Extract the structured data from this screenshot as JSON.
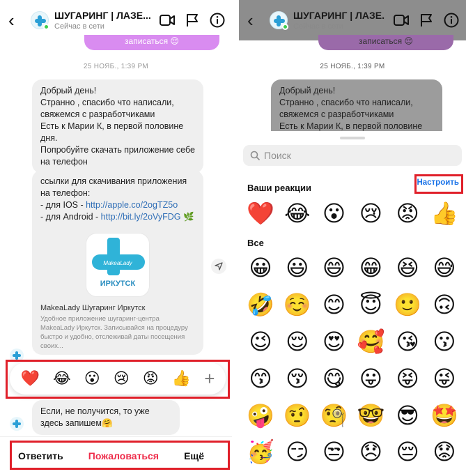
{
  "header": {
    "title": "ШУГАРИНГ | ЛАЗЕ...",
    "status": "Сейчас в сети"
  },
  "chat": {
    "outgoing_snippet": "записаться 😌",
    "date": "25 НОЯБ., 1:39 PM",
    "message1": [
      "Добрый день!",
      "Странно , спасибо что написали, свяжемся с разработчиками",
      "Есть к Марии К, в первой половине дня.",
      "Попробуйте скачать приложение себе на телефон"
    ],
    "message2_intro": "ссылки для скачивания приложения на телефон:",
    "ios_label": " - для IOS - ",
    "ios_link": "http://apple.co/2ogTZ5o",
    "android_label": " - для Android - ",
    "android_link": "http://bit.ly/2oVyFDG",
    "android_emoji": "🌿",
    "logo_brand": "MakeaLady",
    "logo_city": "ИРКУТСК",
    "preview_title": "MakeaLady Шугаринг Иркутск",
    "preview_desc": "Удобное приложение шугаринг-центра MakeaLady Иркутск. Записывайся на процедуру быстро и удобно, отслеживай даты посещения своих...",
    "message3": "Если, не получится, то уже здесь запишем🤗"
  },
  "reaction_bar": [
    "❤️",
    "😂",
    "😮",
    "😢",
    "😡",
    "👍"
  ],
  "actions": {
    "reply": "Ответить",
    "report": "Пожаловаться",
    "more": "Ещё"
  },
  "picker": {
    "search_placeholder": "Поиск",
    "your_reactions_label": "Ваши реакции",
    "customize_label": "Настроить",
    "your_reactions": [
      "❤️",
      "😂",
      "😮",
      "😢",
      "😡",
      "👍"
    ],
    "all_label": "Все",
    "all_rows": [
      [
        "😀",
        "😃",
        "😄",
        "😁",
        "😆",
        "😅"
      ],
      [
        "🤣",
        "☺️",
        "😊",
        "😇",
        "🙂",
        "🙃"
      ],
      [
        "😉",
        "😌",
        "😍",
        "🥰",
        "😘",
        "😗"
      ],
      [
        "😙",
        "😚",
        "😋",
        "😛",
        "😝",
        "😜"
      ],
      [
        "🤪",
        "🤨",
        "🧐",
        "🤓",
        "😎",
        "🤩"
      ],
      [
        "🥳",
        "😏",
        "😒",
        "😞",
        "😔",
        "😟"
      ]
    ]
  },
  "colors": {
    "highlight": "#e0202a",
    "report": "#ee2c4a",
    "link": "#2f6eb6",
    "outgoing_bubble": "#d98cf0",
    "accent_blue": "#1a73e8"
  }
}
